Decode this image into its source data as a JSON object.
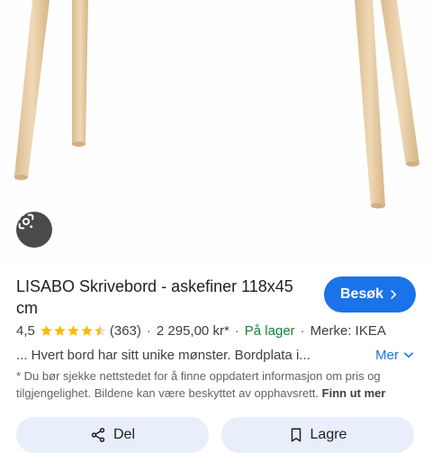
{
  "product": {
    "title": "LISABO Skrivebord - askefiner 118x45 cm",
    "rating": "4,5",
    "rating_value": 4.5,
    "rating_max": 5,
    "review_count": "(363)",
    "price": "2 295,00 kr*",
    "separator": "·",
    "availability": "På lager",
    "brand": "Merke: IKEA",
    "description": "... Hvert bord har sitt unike mønster. Bordplata i...",
    "more_label": "Mer"
  },
  "visit_button": {
    "label": "Besøk"
  },
  "disclaimer": {
    "text": "* Du bør sjekke nettstedet for å finne oppdatert informasjon om pris og tilgjengelighet. Bildene kan være beskyttet av opphavsrett. ",
    "link": "Finn ut mer"
  },
  "actions": {
    "share_label": "Del",
    "save_label": "Lagre"
  },
  "colors": {
    "accent": "#1a73e8",
    "star": "#fbbc04",
    "stock": "#188038",
    "wood": "#e4c9a2"
  },
  "icons": {
    "lens": "google-lens-icon",
    "chevron_right": "chevron-right-icon",
    "chevron_down": "chevron-down-icon",
    "star": "star-icon",
    "share": "share-icon",
    "bookmark": "bookmark-icon"
  }
}
